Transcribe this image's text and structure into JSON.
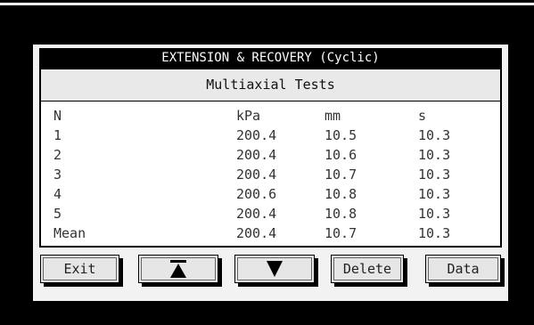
{
  "panel": {
    "title": "EXTENSION & RECOVERY (Cyclic)",
    "subtitle": "Multiaxial Tests"
  },
  "table": {
    "headers": [
      "N",
      "kPa",
      "mm",
      "s"
    ],
    "rows": [
      [
        "1",
        "200.4",
        "10.5",
        "10.3"
      ],
      [
        "2",
        "200.4",
        "10.6",
        "10.3"
      ],
      [
        "3",
        "200.4",
        "10.7",
        "10.3"
      ],
      [
        "4",
        "200.6",
        "10.8",
        "10.3"
      ],
      [
        "5",
        "200.4",
        "10.8",
        "10.3"
      ],
      [
        "Mean",
        "200.4",
        "10.7",
        "10.3"
      ]
    ]
  },
  "buttons": {
    "exit": "Exit",
    "scroll_up_icon": "arrow-up-to-bar-icon",
    "scroll_down_icon": "arrow-down-icon",
    "delete": "Delete",
    "data": "Data"
  },
  "colors": {
    "background": "#000000",
    "panel": "#f2f2f2",
    "title_bar": "#000000",
    "title_text": "#ffffff"
  }
}
